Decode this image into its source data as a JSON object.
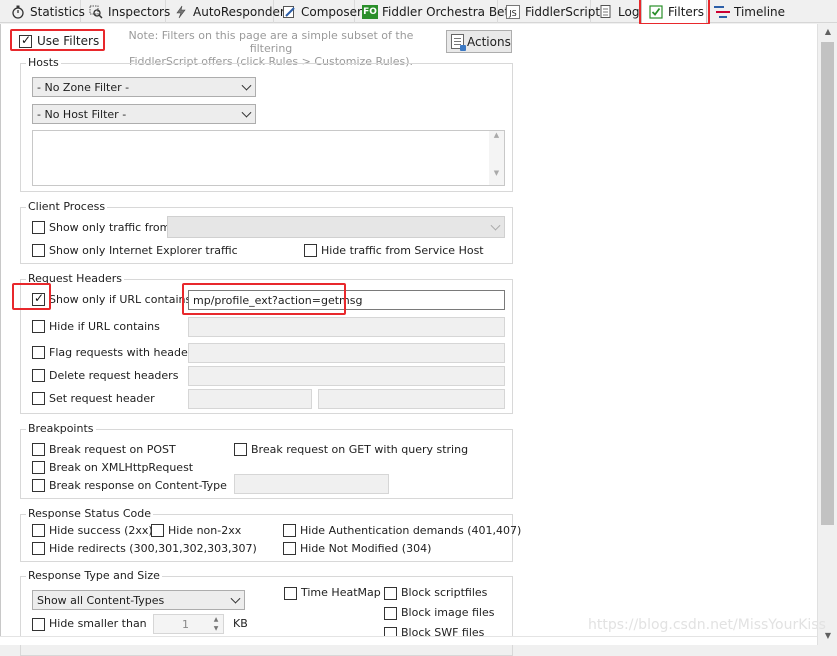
{
  "tabs": [
    {
      "label": "Statistics",
      "icon": "stopwatch-icon"
    },
    {
      "label": "Inspectors",
      "icon": "magnifier-icon"
    },
    {
      "label": "AutoResponder",
      "icon": "lightning-icon"
    },
    {
      "label": "Composer",
      "icon": "pencil-doc-icon"
    },
    {
      "label": "Fiddler Orchestra Beta",
      "icon": "fo-badge-icon",
      "badge": "FO"
    },
    {
      "label": "FiddlerScript",
      "icon": "js-file-icon",
      "badge": "JS"
    },
    {
      "label": "Log",
      "icon": "log-doc-icon"
    },
    {
      "label": "Filters",
      "icon": "checkbox-icon",
      "active": true
    },
    {
      "label": "Timeline",
      "icon": "timeline-icon"
    }
  ],
  "use_filters": {
    "label": "Use Filters",
    "checked": true
  },
  "note": {
    "line1": "Note: Filters on this page are a simple subset of the filtering",
    "line2": "FiddlerScript offers (click Rules > Customize Rules)."
  },
  "actions_label": "Actions",
  "hosts": {
    "title": "Hosts",
    "zone_filter": "- No Zone Filter -",
    "host_filter": "- No Host Filter -"
  },
  "client_process": {
    "title": "Client Process",
    "show_traffic_from": "Show only traffic from",
    "show_ie": "Show only Internet Explorer traffic",
    "hide_service_host": "Hide traffic from Service Host"
  },
  "request_headers": {
    "title": "Request Headers",
    "show_if_url": {
      "label": "Show only if URL contains",
      "checked": true,
      "value": "mp/profile_ext?action=getmsg"
    },
    "hide_if_url": "Hide if URL contains",
    "flag_requests": "Flag requests with headers",
    "delete_headers": "Delete request headers",
    "set_header": "Set request header"
  },
  "breakpoints": {
    "title": "Breakpoints",
    "break_post": "Break request on POST",
    "break_get_query": "Break request on GET with query string",
    "break_xhr": "Break on XMLHttpRequest",
    "break_content_type": "Break response on Content-Type"
  },
  "response_status": {
    "title": "Response Status Code",
    "hide_success": "Hide success (2xx)",
    "hide_non2xx": "Hide non-2xx",
    "hide_auth": "Hide Authentication demands (401,407)",
    "hide_redirects": "Hide redirects (300,301,302,303,307)",
    "hide_not_modified": "Hide Not Modified (304)"
  },
  "response_type": {
    "title": "Response Type and Size",
    "content_types": "Show all Content-Types",
    "time_heatmap": "Time HeatMap",
    "block_script": "Block scriptfiles",
    "block_image": "Block image files",
    "block_swf": "Block SWF files",
    "hide_smaller": "Hide smaller than",
    "size_value": "1",
    "size_unit": "KB"
  },
  "watermark": "https://blog.csdn.net/MissYourKiss",
  "colors": {
    "highlight": "#e8282c",
    "accent": "#2a8f2a"
  }
}
